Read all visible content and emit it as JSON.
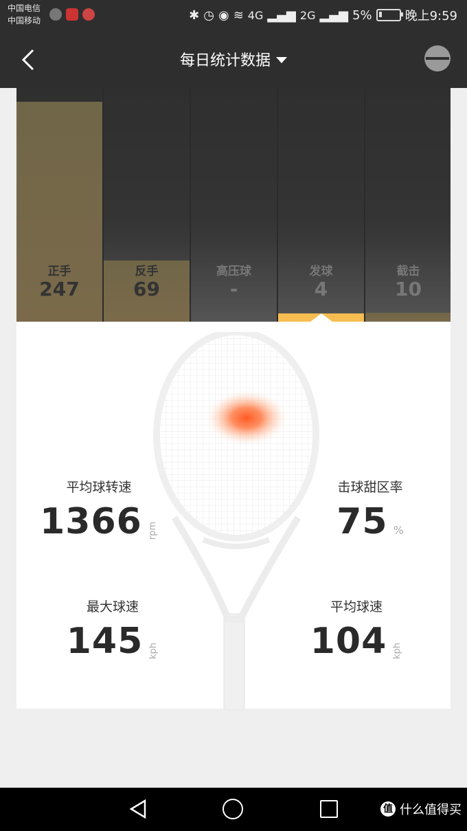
{
  "status_bar": {
    "carrier_1": "中国电信",
    "carrier_2": "中国移动",
    "network_1": "4G",
    "network_2": "2G",
    "battery": "5%",
    "time": "晚上9:59"
  },
  "nav": {
    "title": "每日统计数据"
  },
  "chart_data": {
    "type": "bar",
    "categories": [
      "正手",
      "反手",
      "高压球",
      "发球",
      "截击"
    ],
    "values": [
      247,
      69,
      null,
      4,
      10
    ],
    "display_values": [
      "247",
      "69",
      "-",
      "4",
      "10"
    ],
    "selected_index": 3,
    "colors": {
      "bar": "#756848",
      "indicator": "#f7bd50",
      "active_text": "#333333",
      "inactive_text": "#777777"
    }
  },
  "stats": {
    "avg_spin": {
      "label": "平均球转速",
      "value": "1366",
      "unit": "rpm"
    },
    "sweet_spot": {
      "label": "击球甜区率",
      "value": "75",
      "unit": "%"
    },
    "max_speed": {
      "label": "最大球速",
      "value": "145",
      "unit": "kph"
    },
    "avg_speed": {
      "label": "平均球速",
      "value": "104",
      "unit": "kph"
    }
  },
  "watermark": {
    "logo": "值",
    "text": "什么值得买"
  }
}
